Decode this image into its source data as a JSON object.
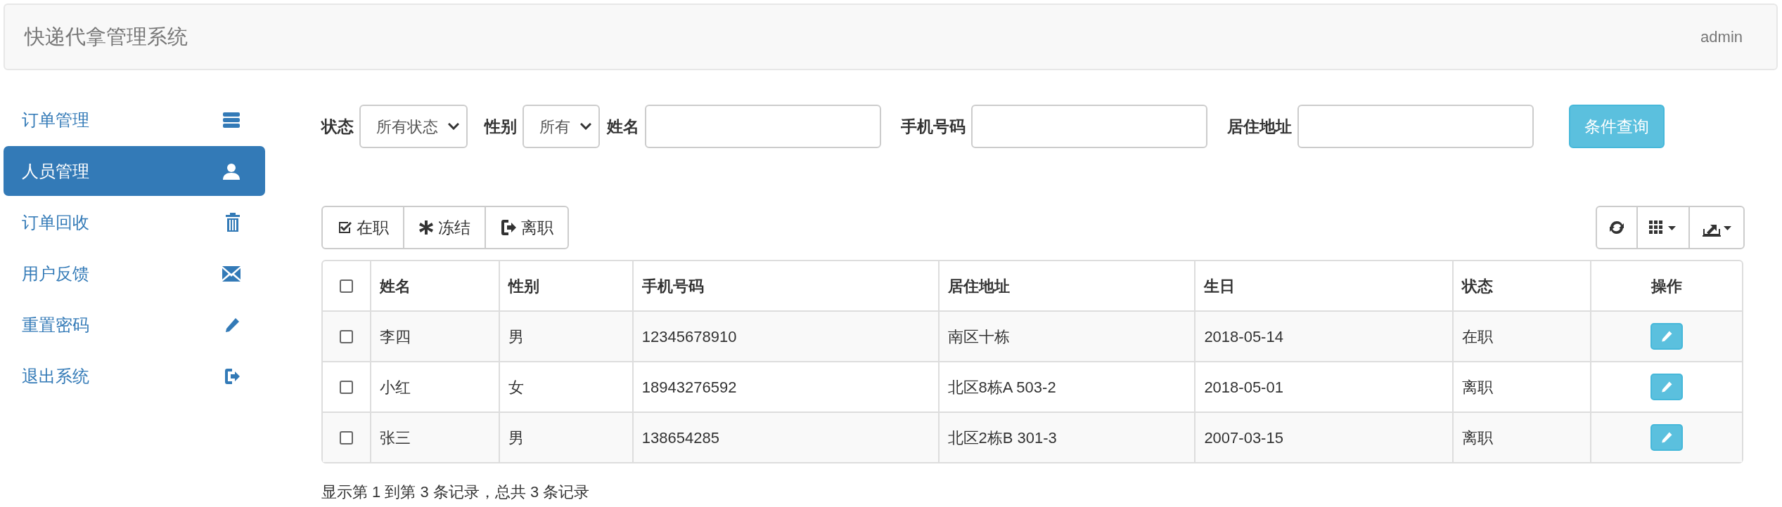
{
  "navbar": {
    "brand": "快递代拿管理系统",
    "user": "admin"
  },
  "sidebar": {
    "items": [
      {
        "label": "订单管理",
        "kind": "server",
        "selected": false
      },
      {
        "label": "人员管理",
        "kind": "user",
        "selected": true
      },
      {
        "label": "订单回收",
        "kind": "trash",
        "selected": false
      },
      {
        "label": "用户反馈",
        "kind": "envelope",
        "selected": false
      },
      {
        "label": "重置密码",
        "kind": "pencil",
        "selected": false
      },
      {
        "label": "退出系统",
        "kind": "logout",
        "selected": false
      }
    ]
  },
  "filters": [
    {
      "label": "状态",
      "kind": "select",
      "value": "所有状态"
    },
    {
      "label": "性别",
      "kind": "select",
      "value": "所有"
    },
    {
      "label": "姓名",
      "kind": "input"
    },
    {
      "label": "手机号码",
      "kind": "input"
    },
    {
      "label": "居住地址",
      "kind": "input"
    }
  ],
  "search_button": "条件查询",
  "actions": [
    {
      "label": "在职",
      "kind": "check"
    },
    {
      "label": "冻结",
      "kind": "asterisk"
    },
    {
      "label": "离职",
      "kind": "logout"
    }
  ],
  "tools": [
    {
      "kind": "refresh"
    },
    {
      "kind": "columns"
    },
    {
      "kind": "export"
    }
  ],
  "table": {
    "select_all_checked": false,
    "columns": [
      "姓名",
      "性别",
      "手机号码",
      "居住地址",
      "生日",
      "状态",
      "操作"
    ],
    "rows": [
      {
        "checked": false,
        "cells": [
          "李四",
          "男",
          "12345678910",
          "南区十栋",
          "2018-05-14",
          "在职"
        ]
      },
      {
        "checked": false,
        "cells": [
          "小红",
          "女",
          "18943276592",
          "北区8栋A 503-2",
          "2018-05-01",
          "离职"
        ]
      },
      {
        "checked": false,
        "cells": [
          "张三",
          "男",
          "138654285",
          "北区2栋B 301-3",
          "2007-03-15",
          "离职"
        ]
      }
    ]
  },
  "pagination_info": "显示第 1 到第 3 条记录，总共 3 条记录"
}
